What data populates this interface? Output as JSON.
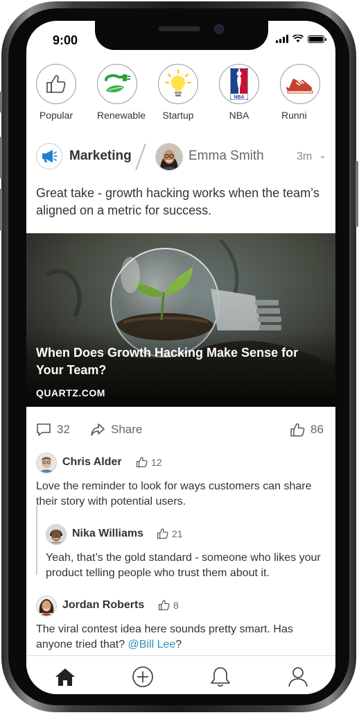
{
  "status_bar": {
    "time": "9:00"
  },
  "topics": [
    {
      "label": "Popular",
      "icon": "thumbs-up-icon"
    },
    {
      "label": "Renewable",
      "icon": "plug-leaf-icon"
    },
    {
      "label": "Startup",
      "icon": "lightbulb-icon"
    },
    {
      "label": "NBA",
      "icon": "nba-logo-icon"
    },
    {
      "label": "Runni",
      "icon": "running-shoe-icon"
    }
  ],
  "post": {
    "channel": "Marketing",
    "author": "Emma Smith",
    "time": "3m",
    "text": "Great take - growth hacking works when the team’s aligned on a metric for success.",
    "article": {
      "title": "When Does Growth Hacking Make Sense for Your Team?",
      "source": "QUARTZ.COM"
    },
    "comments_count": "32",
    "share_label": "Share",
    "likes_count": "86"
  },
  "comments": [
    {
      "name": "Chris Alder",
      "likes": "12",
      "text": "Love the reminder to look for ways customers can share their story with potential users."
    },
    {
      "name": "Nika Williams",
      "likes": "21",
      "text": "Yeah, that’s the gold standard - someone who likes your product telling people who trust them about it."
    },
    {
      "name": "Jordan Roberts",
      "likes": "8",
      "text_before": "The viral contest idea here sounds pretty smart. Has anyone tried that? ",
      "mention": "@Bill Lee",
      "text_after": "?"
    }
  ],
  "colors": {
    "accent": "#2b8fbf",
    "text": "#333333",
    "muted": "#666666"
  }
}
